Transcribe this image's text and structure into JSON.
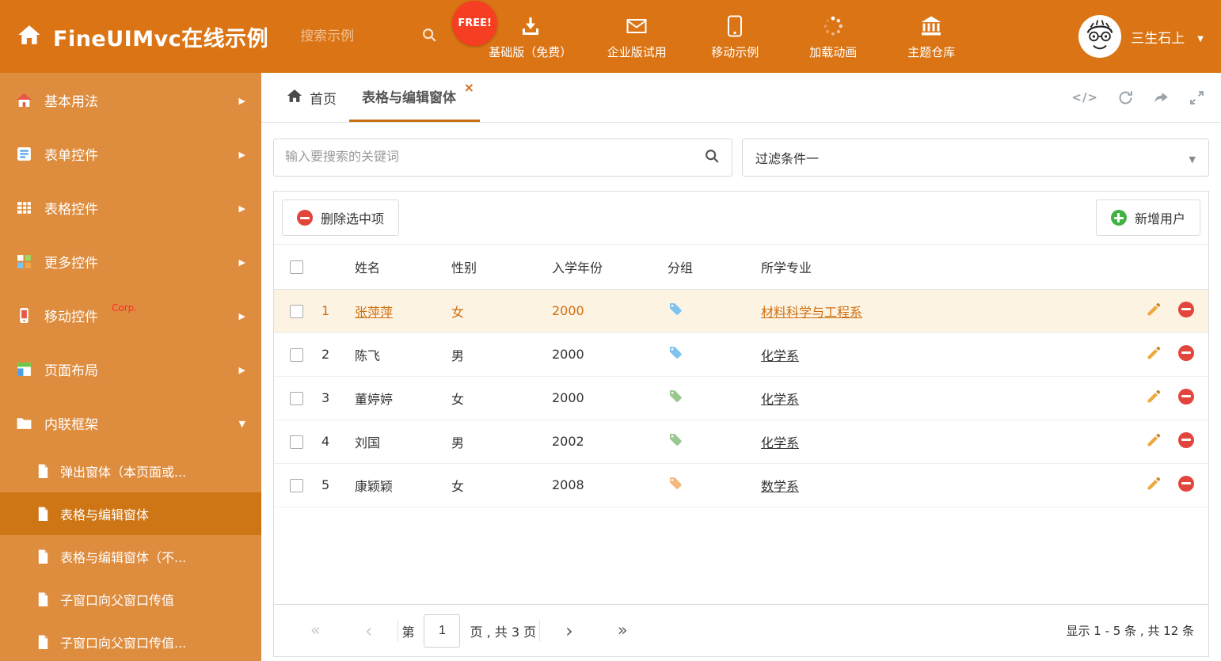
{
  "colors": {
    "header_bg": "#DB7414",
    "sidebar_bg": "#DE8C3D",
    "sidebar_active_bg": "#CE7615",
    "tab_accent": "#C8700F",
    "free_badge_bg": "#F63E23",
    "delete_red": "#E2453C",
    "add_green": "#43B244",
    "highlight_row_bg": "#FDF3E3",
    "highlight_row_text": "#CE6F10"
  },
  "header": {
    "title": "FineUIMvc在线示例",
    "search_placeholder": "搜索示例",
    "free_badge": "FREE!",
    "nav": [
      {
        "label": "基础版（免费）",
        "icon": "download-icon"
      },
      {
        "label": "企业版试用",
        "icon": "envelope-icon"
      },
      {
        "label": "移动示例",
        "icon": "mobile-icon"
      },
      {
        "label": "加载动画",
        "icon": "spinner-icon"
      },
      {
        "label": "主题仓库",
        "icon": "bank-icon"
      }
    ],
    "user_name": "三生石上"
  },
  "sidebar": {
    "items": [
      {
        "label": "基本用法"
      },
      {
        "label": "表单控件"
      },
      {
        "label": "表格控件"
      },
      {
        "label": "更多控件"
      },
      {
        "label": "移动控件",
        "badge": "Corp."
      },
      {
        "label": "页面布局"
      },
      {
        "label": "内联框架"
      }
    ],
    "subitems": [
      {
        "label": "弹出窗体（本页面或..."
      },
      {
        "label": "表格与编辑窗体"
      },
      {
        "label": "表格与编辑窗体（不..."
      },
      {
        "label": "子窗口向父窗口传值"
      },
      {
        "label": "子窗口向父窗口传值..."
      }
    ]
  },
  "tabs": [
    {
      "label": "首页"
    },
    {
      "label": "表格与编辑窗体"
    }
  ],
  "tab_actions": {
    "code_label": "</>"
  },
  "filter": {
    "keyword_placeholder": "输入要搜索的关键词",
    "filter_value": "过滤条件一"
  },
  "toolbar": {
    "delete_label": "删除选中项",
    "add_label": "新增用户"
  },
  "table": {
    "columns": [
      "姓名",
      "性别",
      "入学年份",
      "分组",
      "所学专业"
    ],
    "rows": [
      {
        "num": "1",
        "name": "张萍萍",
        "gender": "女",
        "year": "2000",
        "tag_color": "#7EC3EF",
        "major": "材料科学与工程系"
      },
      {
        "num": "2",
        "name": "陈飞",
        "gender": "男",
        "year": "2000",
        "tag_color": "#7EC3EF",
        "major": "化学系"
      },
      {
        "num": "3",
        "name": "董婷婷",
        "gender": "女",
        "year": "2000",
        "tag_color": "#98C890",
        "major": "化学系"
      },
      {
        "num": "4",
        "name": "刘国",
        "gender": "男",
        "year": "2002",
        "tag_color": "#98C890",
        "major": "化学系"
      },
      {
        "num": "5",
        "name": "康颖颖",
        "gender": "女",
        "year": "2008",
        "tag_color": "#F4B87B",
        "major": "数学系"
      }
    ]
  },
  "pagination": {
    "page_prefix": "第",
    "page": "1",
    "page_suffix": "页 , 共 3 页",
    "summary": "显示 1 - 5 条 , 共 12 条"
  }
}
